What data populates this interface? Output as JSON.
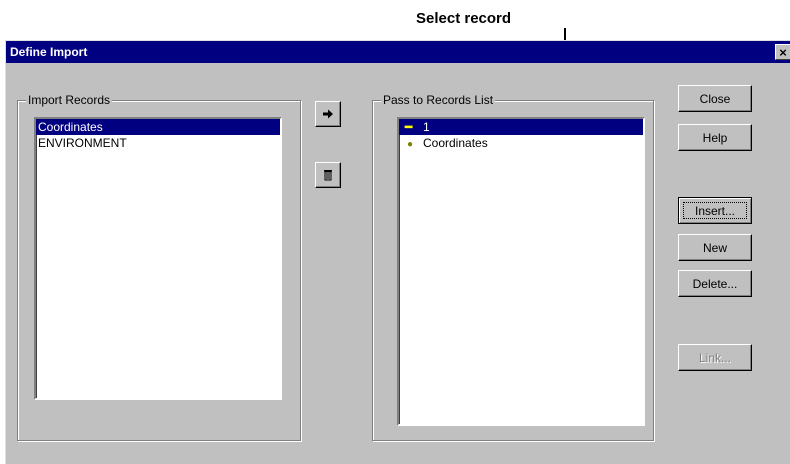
{
  "annotation": {
    "label": "Select record"
  },
  "dialog": {
    "title": "Define Import",
    "close_glyph": "×"
  },
  "import_records": {
    "group_title": "Import Records",
    "items": [
      {
        "label": "Coordinates",
        "selected": true
      },
      {
        "label": "ENVIRONMENT",
        "selected": false
      }
    ]
  },
  "pass_list": {
    "group_title": "Pass to Records List",
    "items": [
      {
        "glyph": "minus-icon",
        "label": "1",
        "selected": true
      },
      {
        "glyph": "bullet-icon",
        "label": "Coordinates",
        "selected": false
      }
    ]
  },
  "transfer": {
    "add_icon": "right-arrow-icon",
    "remove_icon": "trash-icon"
  },
  "buttons": {
    "close": "Close",
    "help": "Help",
    "insert": "Insert...",
    "new": "New",
    "delete": "Delete...",
    "link": "Link..."
  },
  "colors": {
    "titlebar": "#000080",
    "dialog_face": "#c0c0c0",
    "selection": "#000080"
  }
}
